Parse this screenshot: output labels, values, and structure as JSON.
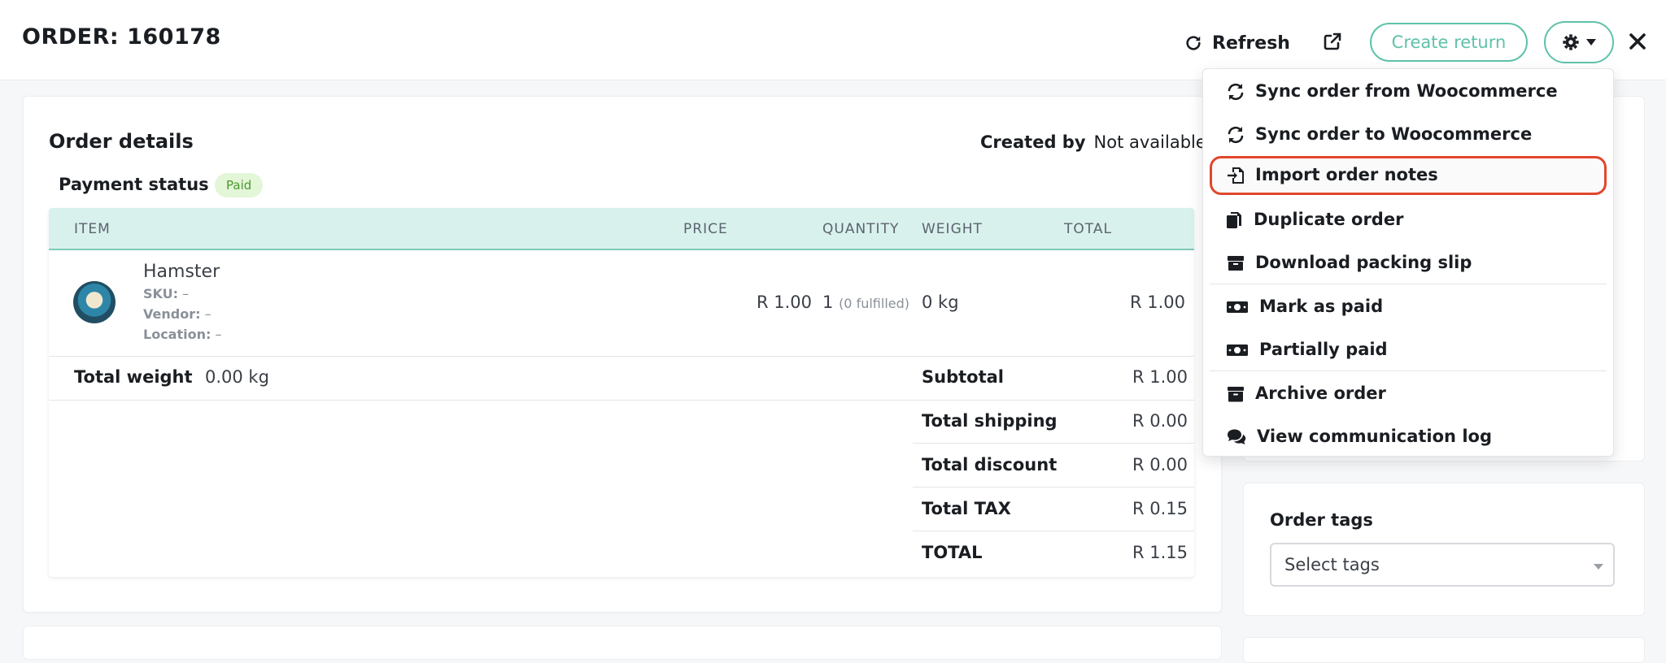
{
  "header": {
    "order_title": "ORDER: 160178",
    "refresh_label": "Refresh",
    "create_return_label": "Create return"
  },
  "order_details": {
    "title": "Order details",
    "created_by_label": "Created by",
    "created_by_value": "Not available",
    "payment_status_label": "Payment status",
    "payment_status_value": "Paid"
  },
  "table": {
    "headers": [
      "ITEM",
      "PRICE",
      "QUANTITY",
      "WEIGHT",
      "TOTAL"
    ],
    "item": {
      "name": "Hamster",
      "sku_label": "SKU:",
      "sku_value": "–",
      "vendor_label": "Vendor:",
      "vendor_value": "–",
      "location_label": "Location:",
      "location_value": "–",
      "price": "R 1.00",
      "quantity": "1",
      "fulfilled": "(0 fulfilled)",
      "weight": "0 kg",
      "total": "R 1.00"
    },
    "total_weight_label": "Total weight",
    "total_weight_value": "0.00 kg"
  },
  "summary": [
    {
      "label": "Subtotal",
      "value": "R 1.00"
    },
    {
      "label": "Total shipping",
      "value": "R 0.00"
    },
    {
      "label": "Total discount",
      "value": "R 0.00"
    },
    {
      "label": "Total TAX",
      "value": "R 0.15"
    },
    {
      "label": "TOTAL",
      "value": "R 1.15"
    }
  ],
  "tags": {
    "title": "Order tags",
    "placeholder": "Select tags"
  },
  "dropdown_menu": [
    {
      "label": "Sync order from Woocommerce",
      "icon": "sync-icon"
    },
    {
      "label": "Sync order to Woocommerce",
      "icon": "sync-icon"
    },
    {
      "label": "Import order notes",
      "icon": "file-import-icon",
      "highlighted": true
    },
    {
      "label": "Duplicate order",
      "icon": "copy-icon"
    },
    {
      "label": "Download packing slip",
      "icon": "box-icon"
    },
    {
      "label": "Mark as paid",
      "icon": "money-bill-icon"
    },
    {
      "label": "Partially paid",
      "icon": "money-bill-icon"
    },
    {
      "label": "Archive order",
      "icon": "archive-icon"
    },
    {
      "label": "View communication log",
      "icon": "comments-icon"
    }
  ],
  "colors": {
    "accent": "#5fc2aa",
    "table_header_bg": "#d9f1ec",
    "paid_badge_bg": "#e3f6d8",
    "paid_badge_text": "#4b9a2e",
    "highlight_border": "#e2462c"
  }
}
